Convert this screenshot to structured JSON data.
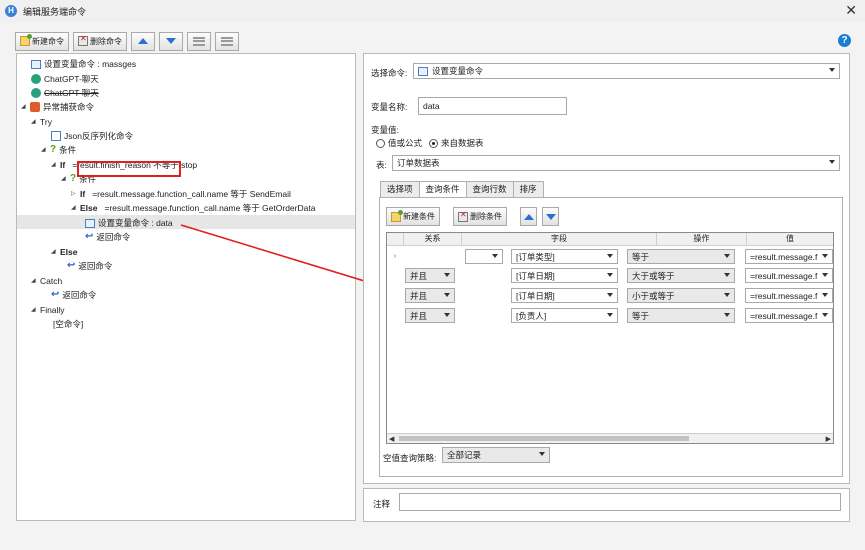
{
  "window": {
    "title": "编辑服务端命令",
    "close": "✕"
  },
  "toolbar": {
    "new_label": "新建命令",
    "delete_label": "删除命令"
  },
  "tree": {
    "items": [
      {
        "text": "设置变量命令 : massges"
      },
      {
        "text": "ChatGPT-聊天"
      },
      {
        "text": "ChatGPT-聊天"
      },
      {
        "text": "异常捕获命令"
      },
      {
        "text": "Try"
      },
      {
        "text": "Json反序列化命令"
      },
      {
        "text": "条件"
      },
      {
        "kw": "If",
        "text": "=result.finish_reason 不等于 stop"
      },
      {
        "text": "条件"
      },
      {
        "kw": "If",
        "text": "=result.message.function_call.name 等于 SendEmail"
      },
      {
        "kw": "Else",
        "text": "=result.message.function_call.name 等于 GetOrderData"
      },
      {
        "text": "设置变量命令 : data"
      },
      {
        "text": "返回命令"
      },
      {
        "kw": "Else",
        "text": ""
      },
      {
        "text": "返回命令"
      },
      {
        "text": "Catch"
      },
      {
        "text": "返回命令"
      },
      {
        "text": "Finally"
      },
      {
        "text": "[空命令]"
      }
    ]
  },
  "right": {
    "select_cmd_label": "选择命令:",
    "select_cmd_value": "设置变量命令",
    "var_name_label": "变量名称:",
    "var_name_value": "data",
    "var_value_label": "变量值:",
    "radio_formula": "值或公式",
    "radio_table": "来自数据表",
    "table_label": "表:",
    "table_value": "订单数据表",
    "tabs": [
      "选择项",
      "查询条件",
      "查询行数",
      "排序"
    ],
    "new_cond_label": "新建条件",
    "del_cond_label": "删除条件",
    "grid_headers": [
      "关系",
      "字段",
      "操作",
      "值"
    ],
    "rows": [
      {
        "rel": "",
        "field": "[订单类型]",
        "op": "等于",
        "val": "=result.message.f"
      },
      {
        "rel": "并且",
        "field": "[订单日期]",
        "op": "大于或等于",
        "val": "=result.message.f"
      },
      {
        "rel": "并且",
        "field": "[订单日期]",
        "op": "小于或等于",
        "val": "=result.message.f"
      },
      {
        "rel": "并且",
        "field": "[负责人]",
        "op": "等于",
        "val": "=result.message.f"
      }
    ],
    "empty_strategy_label": "空值查询策略:",
    "empty_strategy_value": "全部记录",
    "notes_label": "注释"
  }
}
